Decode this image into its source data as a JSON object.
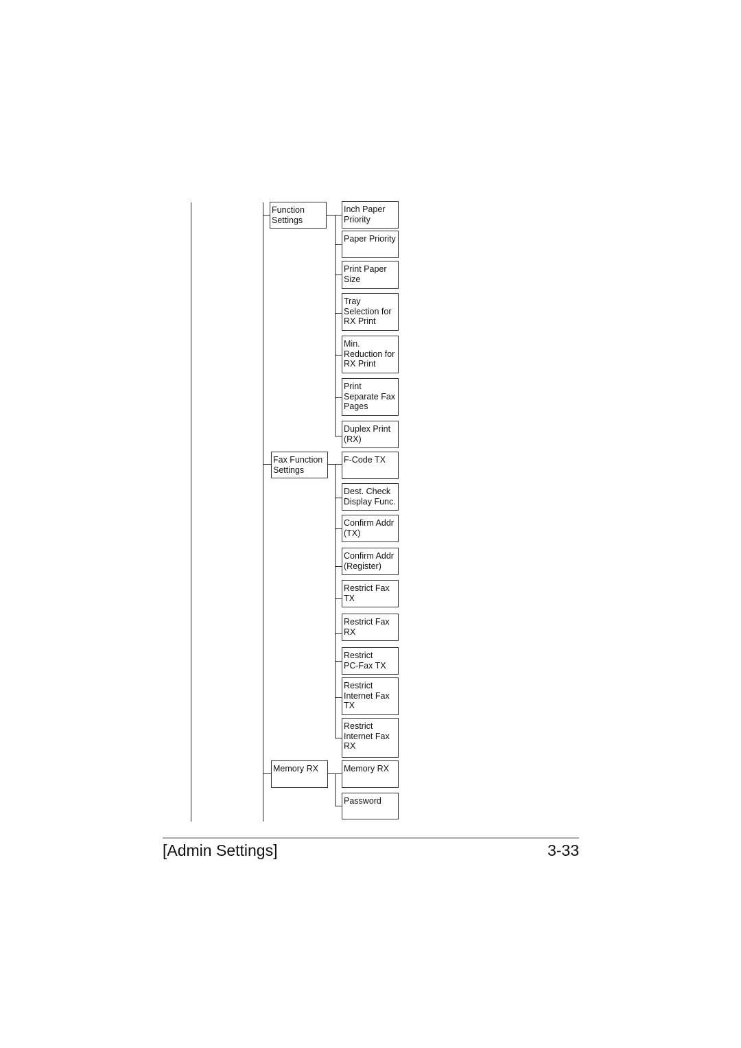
{
  "tree": {
    "groups": [
      {
        "label": "Function Settings",
        "children": [
          "Inch Paper Priority",
          "Paper Priority",
          "Print Paper Size",
          "Tray Selection for RX Print",
          "Min. Reduction for RX Print",
          "Print Separate Fax Pages",
          "Duplex Print (RX)"
        ]
      },
      {
        "label": "Fax Function Settings",
        "children": [
          "F-Code TX",
          "Dest. Check Display Func.",
          "Confirm Addr (TX)",
          "Confirm Addr (Register)",
          "Restrict Fax TX",
          "Restrict Fax RX",
          "Restrict PC-Fax TX",
          "Restrict Internet Fax TX",
          "Restrict Internet Fax RX"
        ]
      },
      {
        "label": "Memory RX",
        "children": [
          "Memory RX",
          "Password"
        ]
      }
    ]
  },
  "labels": {
    "g0": "Function\nSettings",
    "g1": "Fax Function\nSettings",
    "g2": "Memory RX",
    "c00": "Inch Paper\nPriority",
    "c01": "Paper Priority",
    "c02": "Print Paper\nSize",
    "c03": "Tray\nSelection for\nRX Print",
    "c04": "Min.\nReduction for\nRX Print",
    "c05": "Print\nSeparate Fax\nPages",
    "c06": "Duplex Print\n(RX)",
    "c10": "F-Code TX",
    "c11": "Dest. Check\nDisplay Func.",
    "c12": "Confirm Addr\n(TX)",
    "c13": "Confirm Addr\n(Register)",
    "c14": "Restrict Fax\nTX",
    "c15": "Restrict Fax\nRX",
    "c16": "Restrict\nPC-Fax TX",
    "c17": "Restrict\nInternet Fax\nTX",
    "c18": "Restrict\nInternet Fax\nRX",
    "c20": "Memory RX",
    "c21": "Password"
  },
  "footer": {
    "section_title": "[Admin Settings]",
    "page_number": "3-33"
  }
}
